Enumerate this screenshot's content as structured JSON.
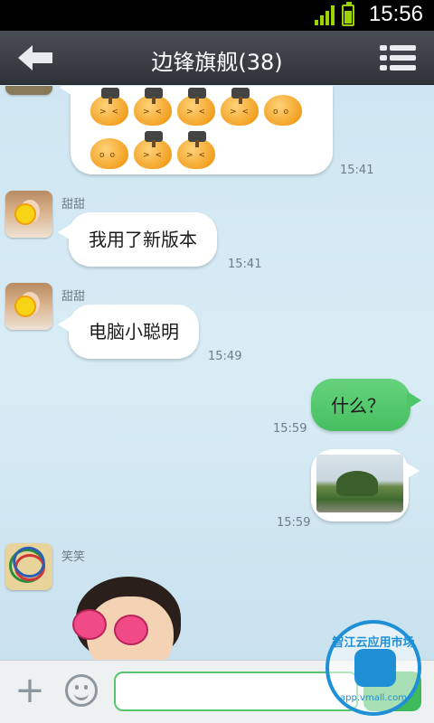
{
  "status_bar": {
    "time": "15:56"
  },
  "header": {
    "title": "边锋旗舰(38)"
  },
  "messages": {
    "m1": {
      "time": "15:41"
    },
    "m2": {
      "sender": "甜甜",
      "text": "我用了新版本",
      "time": "15:41"
    },
    "m3": {
      "sender": "甜甜",
      "text": "电脑小聪明",
      "time": "15:49"
    },
    "m4": {
      "text": "什么？",
      "time": "15:59"
    },
    "m5": {
      "time": "15:59"
    },
    "m6": {
      "sender": "笑笑"
    }
  },
  "input": {
    "placeholder": ""
  },
  "watermark": {
    "top_text": "智江云应用市场",
    "bottom_text": "app.vmall.com"
  },
  "colors": {
    "accent_green": "#46bf60",
    "header_bg": "#2e3338"
  }
}
